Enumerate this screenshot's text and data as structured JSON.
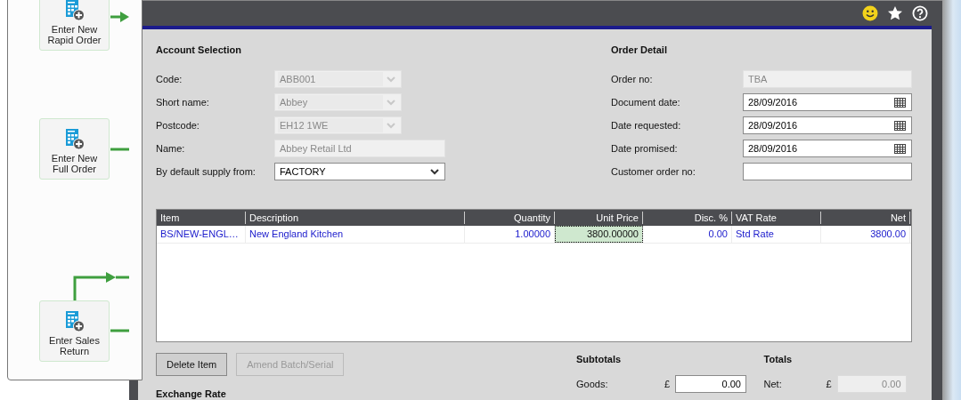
{
  "workflow": {
    "nodes": [
      {
        "label": "Enter New\nRapid Order"
      },
      {
        "label": "Enter New\nFull Order"
      },
      {
        "label": "Enter Sales\nReturn"
      }
    ]
  },
  "account": {
    "title": "Account Selection",
    "fields": [
      {
        "label": "Code:",
        "kind": "combo",
        "value": "ABB001",
        "disabled": true
      },
      {
        "label": "Short name:",
        "kind": "combo",
        "value": "Abbey",
        "disabled": true
      },
      {
        "label": "Postcode:",
        "kind": "combo",
        "value": "EH12 1WE",
        "disabled": true
      },
      {
        "label": "Name:",
        "kind": "text",
        "value": "Abbey Retail Ltd",
        "disabled": true
      },
      {
        "label": "By default supply from:",
        "kind": "select",
        "value": "FACTORY",
        "disabled": false
      }
    ]
  },
  "order": {
    "title": "Order Detail",
    "fields": [
      {
        "label": "Order no:",
        "kind": "text",
        "value": "TBA",
        "disabled": true
      },
      {
        "label": "Document date:",
        "kind": "date",
        "value": "28/09/2016",
        "disabled": false
      },
      {
        "label": "Date requested:",
        "kind": "date",
        "value": "28/09/2016",
        "disabled": false
      },
      {
        "label": "Date promised:",
        "kind": "date",
        "value": "28/09/2016",
        "disabled": false
      },
      {
        "label": "Customer order no:",
        "kind": "text",
        "disabled": false
      }
    ]
  },
  "grid": {
    "columns": [
      {
        "label": "Item",
        "kind": "text"
      },
      {
        "label": "Description",
        "kind": "text"
      },
      {
        "label": "Quantity",
        "kind": "numeric"
      },
      {
        "label": "Unit Price",
        "kind": "numeric"
      },
      {
        "label": "Disc. %",
        "kind": "numeric"
      },
      {
        "label": "VAT Rate",
        "kind": "text"
      },
      {
        "label": "Net",
        "kind": "numeric"
      }
    ],
    "rows": [
      {
        "cells": [
          {
            "text": "BS/NEW-ENGL…",
            "selected": false
          },
          {
            "text": "New England Kitchen",
            "selected": false
          },
          {
            "text": "1.00000",
            "selected": false
          },
          {
            "text": "3800.00000",
            "selected": true
          },
          {
            "text": "0.00",
            "selected": false
          },
          {
            "text": "Std Rate",
            "selected": false
          },
          {
            "text": "3800.00",
            "selected": false
          }
        ]
      }
    ]
  },
  "buttons": [
    {
      "label": "Delete Item",
      "disabled": false
    },
    {
      "label": "Amend Batch/Serial",
      "disabled": true
    }
  ],
  "exchange_rate": {
    "title": "Exchange Rate"
  },
  "subtotals": {
    "title": "Subtotals",
    "rows": [
      {
        "label": "Goods:",
        "currency": "£",
        "value": "0.00",
        "disabled": false
      }
    ]
  },
  "totals": {
    "title": "Totals",
    "rows": [
      {
        "label": "Net:",
        "currency": "£",
        "value": "0.00",
        "disabled": true
      }
    ]
  }
}
